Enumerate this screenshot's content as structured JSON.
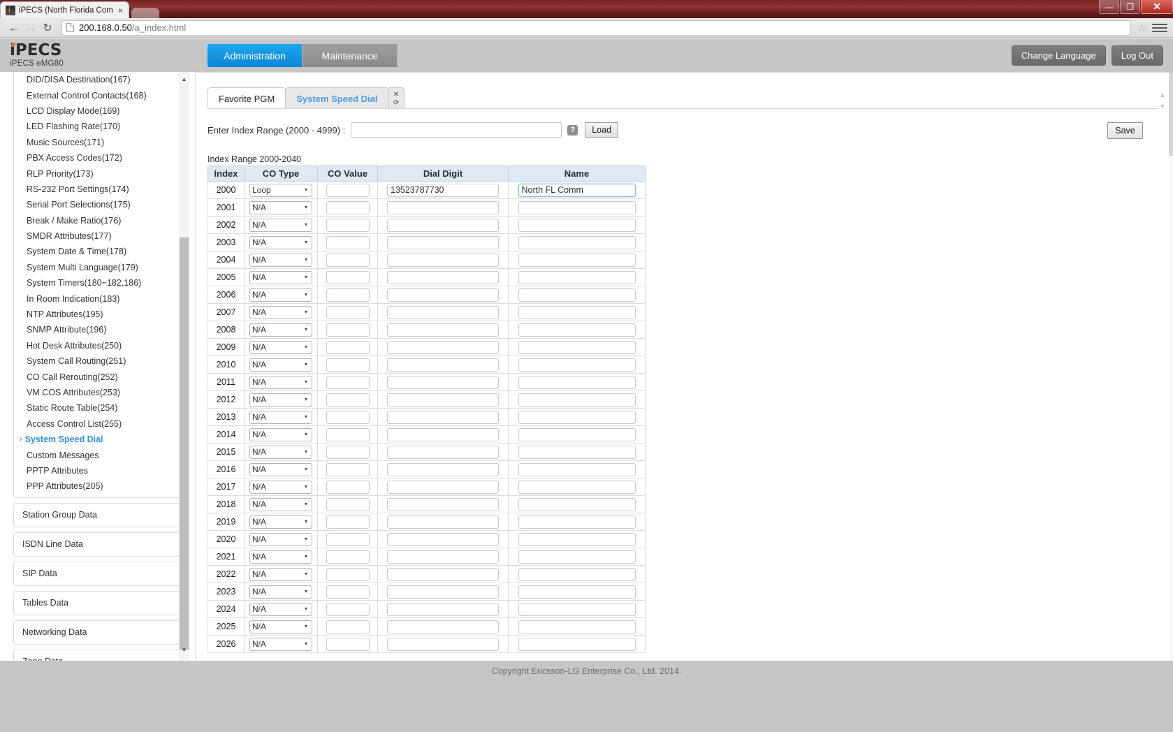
{
  "browser": {
    "tab_title": "iPECS (North Florida Com",
    "tab_close": "×",
    "url_host": "200.168.0.50",
    "url_path": "/a_index.html",
    "back_icon": "←",
    "forward_icon": "→",
    "reload_icon": "↻",
    "star_icon": "☆",
    "minimize": "—",
    "maximize": "❐",
    "close": "✕"
  },
  "header": {
    "logo": "iPECS",
    "logo_sub": "iPECS eMG80",
    "tabs": [
      {
        "label": "Administration",
        "active": true
      },
      {
        "label": "Maintenance",
        "active": false
      }
    ],
    "change_language": "Change Language",
    "log_out": "Log Out"
  },
  "sidebar": {
    "items": [
      "DID/DISA Destination(167)",
      "External Control Contacts(168)",
      "LCD Display Mode(169)",
      "LED Flashing Rate(170)",
      "Music Sources(171)",
      "PBX Access Codes(172)",
      "RLP Priority(173)",
      "RS-232 Port Settings(174)",
      "Serial Port Selections(175)",
      "Break / Make Ratio(176)",
      "SMDR Attributes(177)",
      "System Date & Time(178)",
      "System Multi Language(179)",
      "System Timers(180~182,186)",
      "In Room Indication(183)",
      "NTP Attributes(195)",
      "SNMP Attribute(196)",
      "Hot Desk Attributes(250)",
      "System Call Routing(251)",
      "CO Call Rerouting(252)",
      "VM COS Attributes(253)",
      "Static Route Table(254)",
      "Access Control List(255)"
    ],
    "active_item": "System Speed Dial",
    "active_chevron": "›",
    "items_after": [
      "Custom Messages",
      "PPTP Attributes",
      "PPP Attributes(205)"
    ],
    "categories": [
      "Station Group Data",
      "ISDN Line Data",
      "SIP Data",
      "Tables Data",
      "Networking Data",
      "Zone Data"
    ],
    "scroll_up_icon": "▲",
    "scroll_down_icon": "▼"
  },
  "main": {
    "tabs": [
      {
        "label": "Favorite PGM",
        "selected": false
      },
      {
        "label": "System Speed Dial",
        "selected": true
      }
    ],
    "tab_close_icon": "✕",
    "tab_refresh_icon": "⟳",
    "range_label": "Enter Index Range (2000 - 4999) :",
    "range_value": "",
    "range_placeholder": "",
    "help_icon": "?",
    "load_label": "Load",
    "save_label": "Save",
    "range_caption": "Index Range 2000-2040",
    "columns": [
      "Index",
      "CO Type",
      "CO Value",
      "Dial Digit",
      "Name"
    ],
    "co_type_options": [
      "N/A",
      "Loop"
    ],
    "caret_icon": "▾",
    "rows": [
      {
        "index": "2000",
        "co_type": "Loop",
        "co_value": "",
        "dial_digit": "13523787730",
        "name": "North FL Comm",
        "name_focused": true
      },
      {
        "index": "2001",
        "co_type": "N/A",
        "co_value": "",
        "dial_digit": "",
        "name": "",
        "name_focused": false
      },
      {
        "index": "2002",
        "co_type": "N/A",
        "co_value": "",
        "dial_digit": "",
        "name": "",
        "name_focused": false
      },
      {
        "index": "2003",
        "co_type": "N/A",
        "co_value": "",
        "dial_digit": "",
        "name": "",
        "name_focused": false
      },
      {
        "index": "2004",
        "co_type": "N/A",
        "co_value": "",
        "dial_digit": "",
        "name": "",
        "name_focused": false
      },
      {
        "index": "2005",
        "co_type": "N/A",
        "co_value": "",
        "dial_digit": "",
        "name": "",
        "name_focused": false
      },
      {
        "index": "2006",
        "co_type": "N/A",
        "co_value": "",
        "dial_digit": "",
        "name": "",
        "name_focused": false
      },
      {
        "index": "2007",
        "co_type": "N/A",
        "co_value": "",
        "dial_digit": "",
        "name": "",
        "name_focused": false
      },
      {
        "index": "2008",
        "co_type": "N/A",
        "co_value": "",
        "dial_digit": "",
        "name": "",
        "name_focused": false
      },
      {
        "index": "2009",
        "co_type": "N/A",
        "co_value": "",
        "dial_digit": "",
        "name": "",
        "name_focused": false
      },
      {
        "index": "2010",
        "co_type": "N/A",
        "co_value": "",
        "dial_digit": "",
        "name": "",
        "name_focused": false
      },
      {
        "index": "2011",
        "co_type": "N/A",
        "co_value": "",
        "dial_digit": "",
        "name": "",
        "name_focused": false
      },
      {
        "index": "2012",
        "co_type": "N/A",
        "co_value": "",
        "dial_digit": "",
        "name": "",
        "name_focused": false
      },
      {
        "index": "2013",
        "co_type": "N/A",
        "co_value": "",
        "dial_digit": "",
        "name": "",
        "name_focused": false
      },
      {
        "index": "2014",
        "co_type": "N/A",
        "co_value": "",
        "dial_digit": "",
        "name": "",
        "name_focused": false
      },
      {
        "index": "2015",
        "co_type": "N/A",
        "co_value": "",
        "dial_digit": "",
        "name": "",
        "name_focused": false
      },
      {
        "index": "2016",
        "co_type": "N/A",
        "co_value": "",
        "dial_digit": "",
        "name": "",
        "name_focused": false
      },
      {
        "index": "2017",
        "co_type": "N/A",
        "co_value": "",
        "dial_digit": "",
        "name": "",
        "name_focused": false
      },
      {
        "index": "2018",
        "co_type": "N/A",
        "co_value": "",
        "dial_digit": "",
        "name": "",
        "name_focused": false
      },
      {
        "index": "2019",
        "co_type": "N/A",
        "co_value": "",
        "dial_digit": "",
        "name": "",
        "name_focused": false
      },
      {
        "index": "2020",
        "co_type": "N/A",
        "co_value": "",
        "dial_digit": "",
        "name": "",
        "name_focused": false
      },
      {
        "index": "2021",
        "co_type": "N/A",
        "co_value": "",
        "dial_digit": "",
        "name": "",
        "name_focused": false
      },
      {
        "index": "2022",
        "co_type": "N/A",
        "co_value": "",
        "dial_digit": "",
        "name": "",
        "name_focused": false
      },
      {
        "index": "2023",
        "co_type": "N/A",
        "co_value": "",
        "dial_digit": "",
        "name": "",
        "name_focused": false
      },
      {
        "index": "2024",
        "co_type": "N/A",
        "co_value": "",
        "dial_digit": "",
        "name": "",
        "name_focused": false
      },
      {
        "index": "2025",
        "co_type": "N/A",
        "co_value": "",
        "dial_digit": "",
        "name": "",
        "name_focused": false
      },
      {
        "index": "2026",
        "co_type": "N/A",
        "co_value": "",
        "dial_digit": "",
        "name": "",
        "name_focused": false
      }
    ]
  },
  "footer": {
    "copyright": "Copyright Ericsson-LG Enterprise Co., Ltd. 2014."
  },
  "colors": {
    "accent_blue": "#0b86d6",
    "link_blue": "#4d9ee6",
    "header_gray": "#c6c6c6",
    "table_header": "#dceaf5",
    "titlebar_red": "#913030"
  }
}
